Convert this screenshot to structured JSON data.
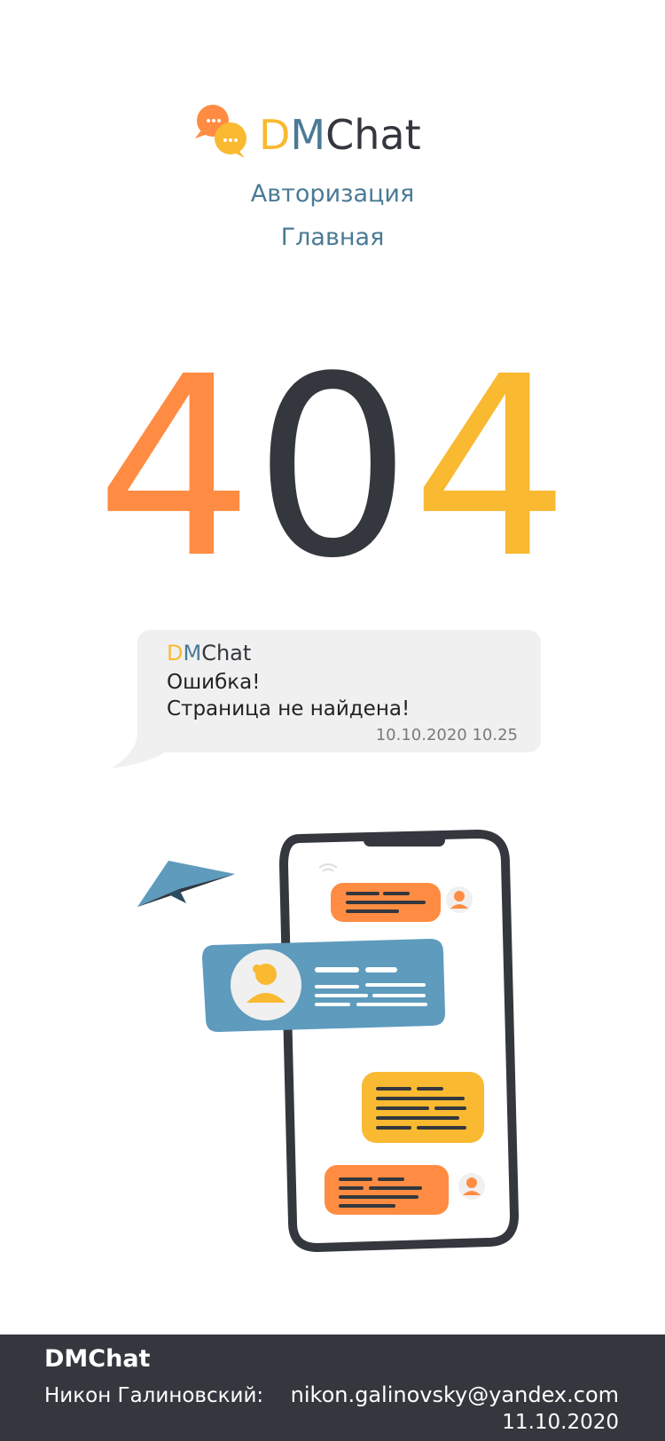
{
  "header": {
    "brand": {
      "d": "D",
      "m": "M",
      "rest": "Chat"
    },
    "nav": [
      {
        "label": "Авторизация"
      },
      {
        "label": "Главная"
      }
    ]
  },
  "error": {
    "digit1": "4",
    "digit2": "0",
    "digit3": "4"
  },
  "message": {
    "brand": {
      "d": "D",
      "m": "M",
      "rest": "Chat"
    },
    "title": "Ошибка!",
    "text": "Страница не найдена!",
    "time": "10.10.2020 10.25"
  },
  "footer": {
    "brand": "DMChat",
    "author": "Никон Галиновский:",
    "email": "nikon.galinovsky@yandex.com",
    "date": "11.10.2020"
  },
  "colors": {
    "orange": "#FF8C42",
    "yellow": "#F9B931",
    "blue": "#4A7A95",
    "dark": "#34373D",
    "card_blue": "#5E9BBD"
  },
  "icons": [
    "chat-bubbles-logo-icon",
    "paper-plane-icon",
    "phone-chat-illustration",
    "avatar-icon"
  ]
}
